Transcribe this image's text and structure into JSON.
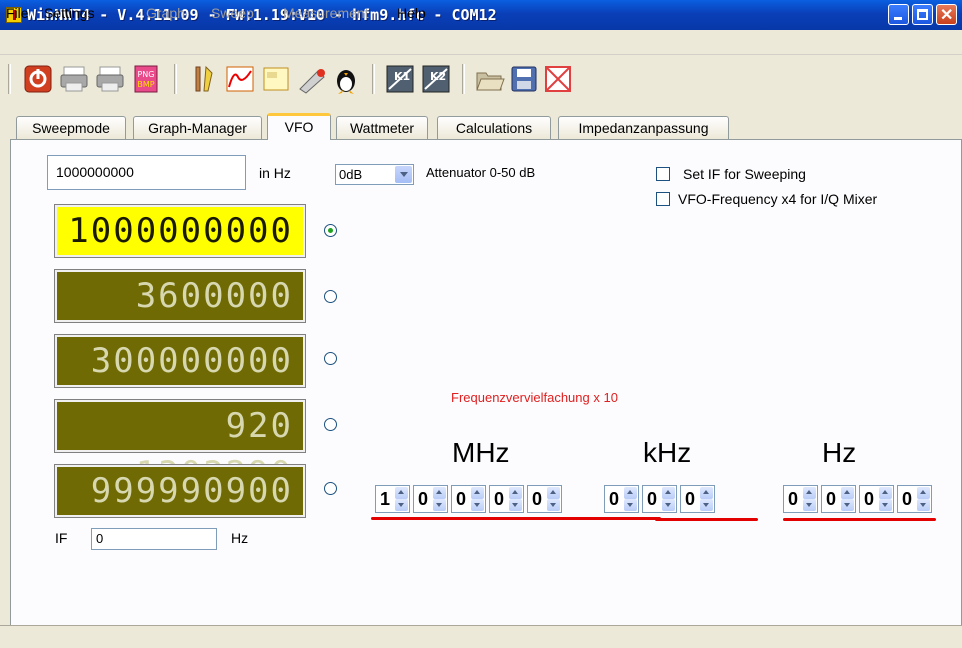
{
  "window": {
    "title": "WinNWT4 - V.4.11.09 - FW:1.19:V10 - hfm9.hfc - COM12"
  },
  "menu": [
    {
      "label": "File",
      "enabled": true
    },
    {
      "label": "Settings",
      "enabled": true
    },
    {
      "label": "Graph",
      "enabled": false
    },
    {
      "label": "Sweep",
      "enabled": false
    },
    {
      "label": "Measurement",
      "enabled": false
    },
    {
      "label": "Help",
      "enabled": true
    }
  ],
  "toolbar": {
    "icons": [
      "power-icon",
      "printer-icon",
      "printer-icon",
      "png-bmp-export-icon",
      "tools-icon",
      "graph-icon",
      "window-icon",
      "probe-icon",
      "linux-icon",
      "k1-calibration-icon",
      "k2-calibration-icon",
      "open-folder-icon",
      "save-icon",
      "sweep-icon"
    ]
  },
  "tabs": [
    "Sweepmode",
    "Graph-Manager",
    "VFO",
    "Wattmeter",
    "Calculations",
    "Impedanzanpassung"
  ],
  "active_tab": "VFO",
  "vfo": {
    "frequency_value": "1000000000",
    "frequency_unit": "in Hz",
    "attenuator_value": "0dB",
    "attenuator_label": "Attenuator 0-50 dB",
    "set_if_label": "Set  IF for Sweeping",
    "vfo_x4_label": "VFO-Frequency x4 for I/Q Mixer",
    "lcd_values": [
      "1000000000",
      "3600000",
      "300000000",
      "920 1303290",
      "999990900"
    ],
    "selected_index": 0,
    "if_label": "IF",
    "if_value": "0",
    "if_unit": "Hz",
    "multiplier_label": "Frequenzvervielfachung x 10",
    "units": {
      "mhz": "MHz",
      "khz": "kHz",
      "hz": "Hz"
    },
    "digits": [
      "1",
      "0",
      "0",
      "0",
      "0",
      "0",
      "0",
      "0",
      "0",
      "0"
    ]
  },
  "colors": {
    "lcd_active": "#ffff00",
    "lcd_inactive": "#6f6a03",
    "accent_red": "#e20000"
  }
}
